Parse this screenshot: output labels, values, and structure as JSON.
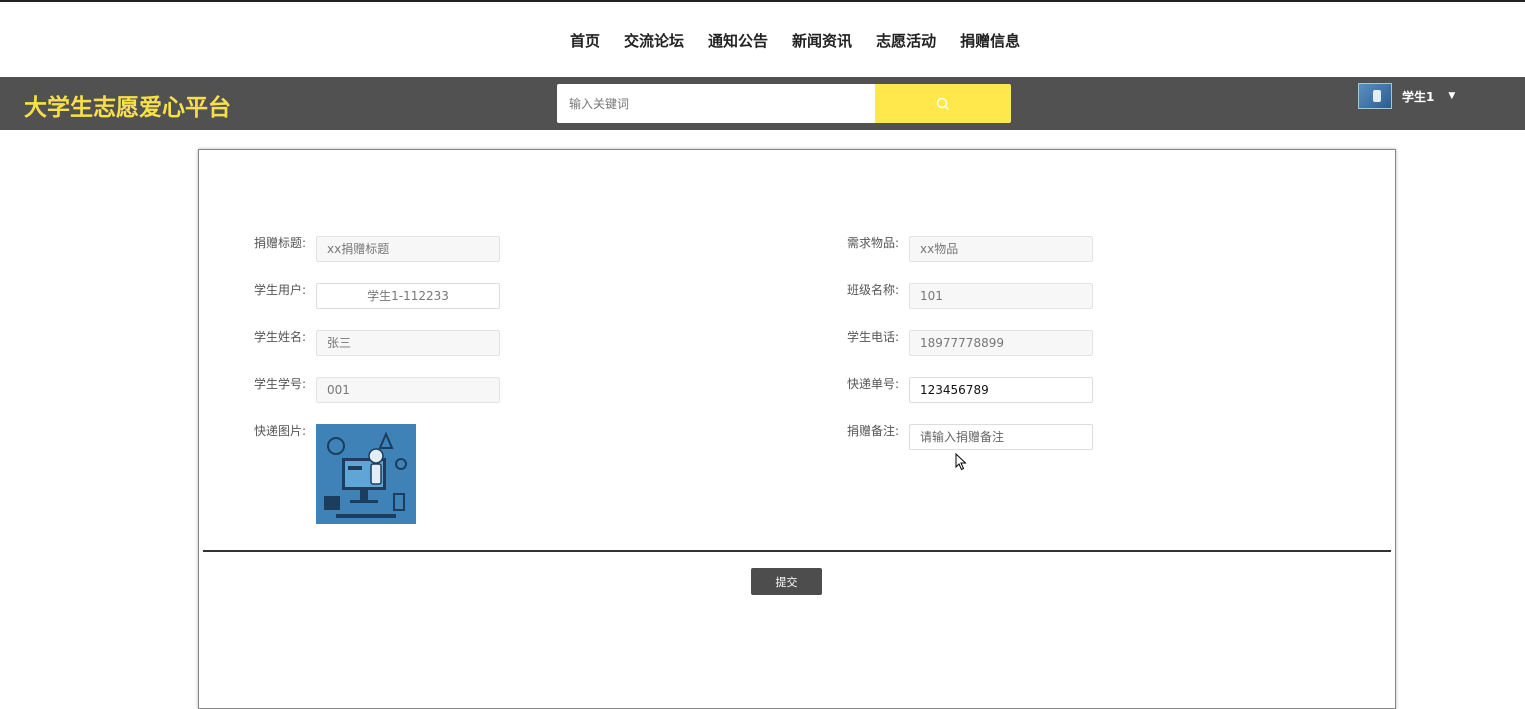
{
  "nav": {
    "items": [
      "首页",
      "交流论坛",
      "通知公告",
      "新闻资讯",
      "志愿活动",
      "捐赠信息"
    ]
  },
  "header": {
    "logo": "大学生志愿爱心平台",
    "search_placeholder": "输入关键词",
    "user_name": "学生1",
    "bg_color": "#515151",
    "accent_color": "#ffe84c"
  },
  "form": {
    "left": [
      {
        "label": "捐赠标题:",
        "value": "xx捐赠标题"
      },
      {
        "label": "学生用户:",
        "value": "学生1-112233"
      },
      {
        "label": "学生姓名:",
        "value": "张三"
      },
      {
        "label": "学生学号:",
        "value": "001"
      },
      {
        "label": "快递图片:",
        "image": "robot-lesson-illustration"
      }
    ],
    "right": [
      {
        "label": "需求物品:",
        "value": "xx物品"
      },
      {
        "label": "班级名称:",
        "value": "101"
      },
      {
        "label": "学生电话:",
        "value": "18977778899"
      },
      {
        "label": "快递单号:",
        "value": "123456789"
      },
      {
        "label": "捐赠备注:",
        "placeholder": "请输入捐赠备注"
      }
    ],
    "submit_label": "提交"
  }
}
